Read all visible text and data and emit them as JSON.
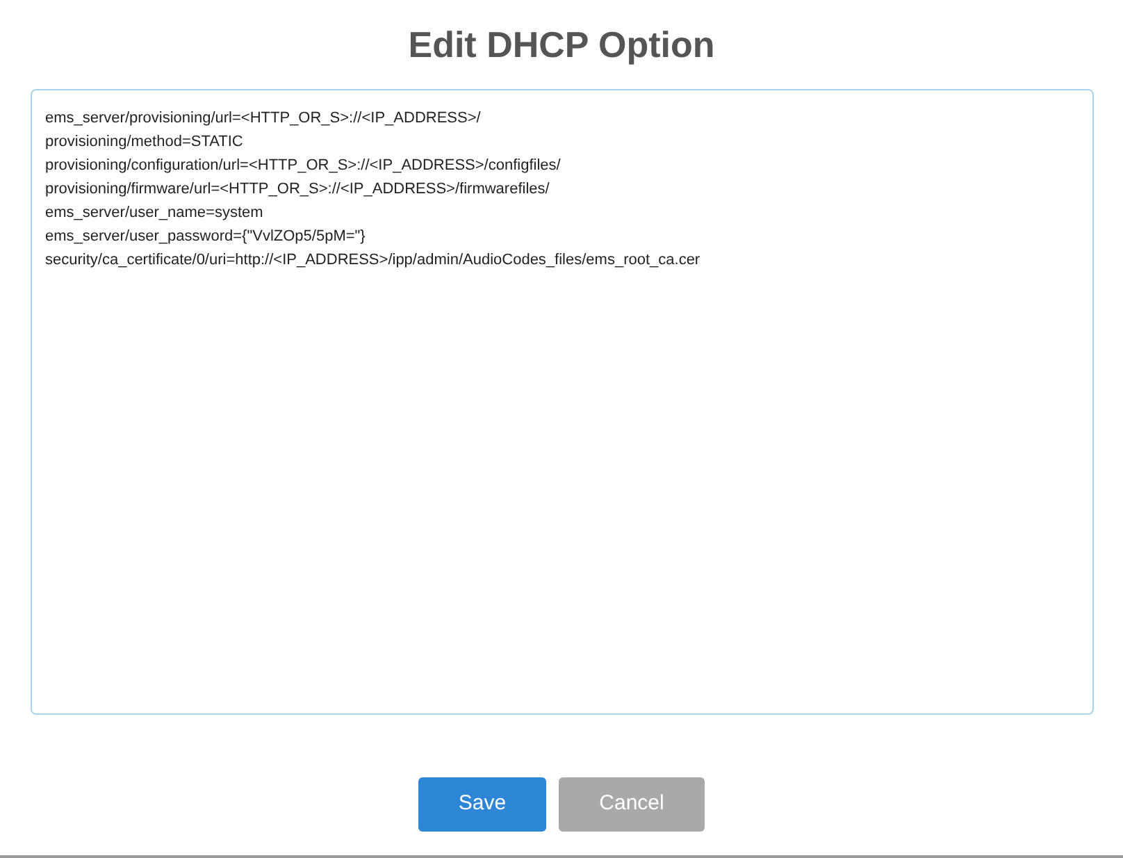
{
  "dialog": {
    "title": "Edit DHCP Option",
    "option_text": [
      "ems_server/provisioning/url=<HTTP_OR_S>://<IP_ADDRESS>/",
      "provisioning/method=STATIC",
      "provisioning/configuration/url=<HTTP_OR_S>://<IP_ADDRESS>/configfiles/",
      "provisioning/firmware/url=<HTTP_OR_S>://<IP_ADDRESS>/firmwarefiles/",
      "ems_server/user_name=system",
      "ems_server/user_password={\"VvlZOp5/5pM=\"}",
      "security/ca_certificate/0/uri=http://<IP_ADDRESS>/ipp/admin/AudioCodes_files/ems_root_ca.cer"
    ],
    "buttons": [
      {
        "label": "Save",
        "kind": "primary"
      },
      {
        "label": "Cancel",
        "kind": "secondary"
      }
    ]
  }
}
